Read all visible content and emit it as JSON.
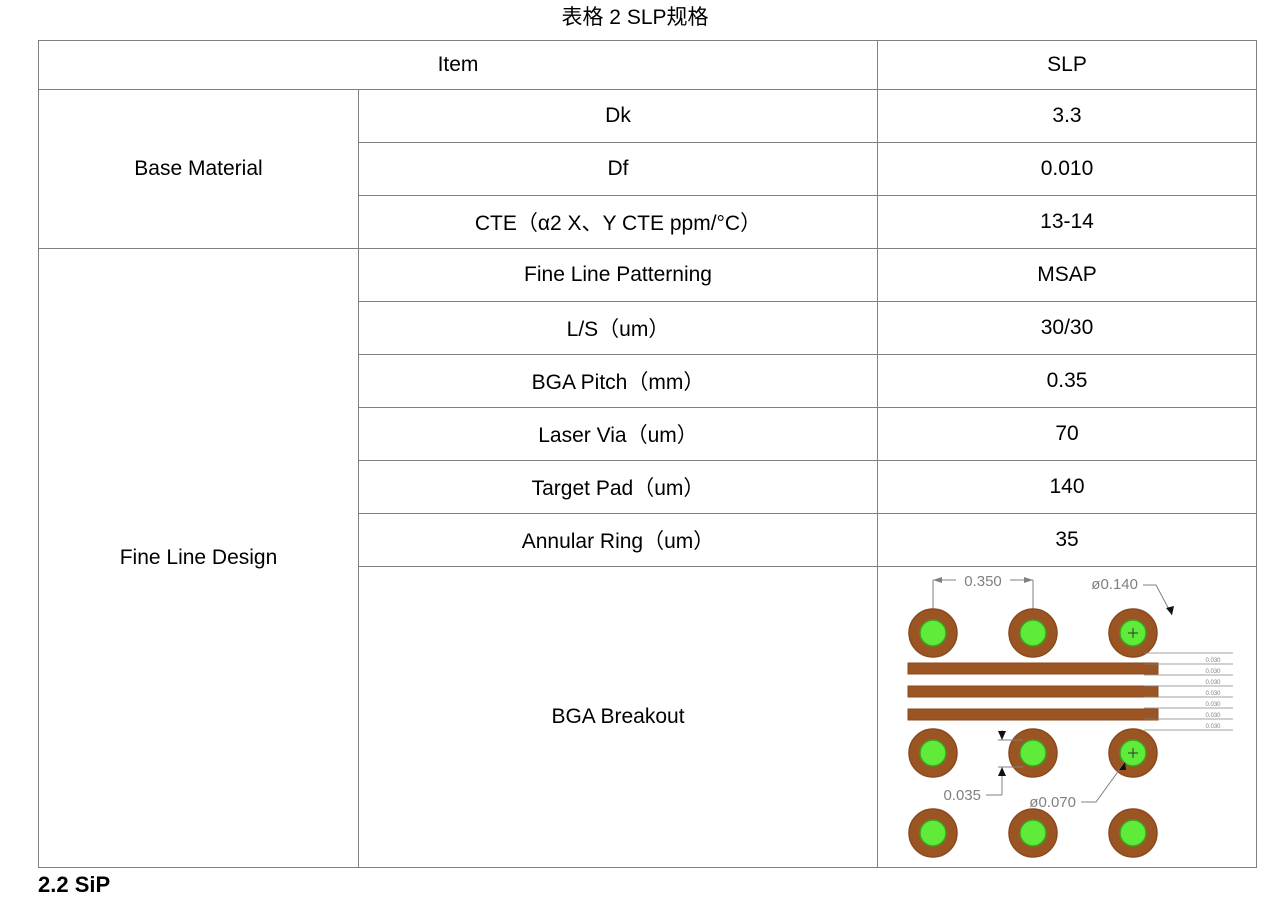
{
  "title": "表格 2 SLP规格",
  "table": {
    "header": {
      "item_label": "Item",
      "value_label": "SLP"
    },
    "groups": [
      {
        "name": "Base Material",
        "rows": [
          {
            "item": "Dk",
            "value": "3.3"
          },
          {
            "item": "Df",
            "value": "0.010"
          },
          {
            "item": "CTE（α2 X、Y CTE ppm/°C）",
            "value": "13-14"
          }
        ]
      },
      {
        "name": "Fine Line Design",
        "rows": [
          {
            "item": "Fine Line Patterning",
            "value": "MSAP"
          },
          {
            "item": "L/S（um）",
            "value": "30/30"
          },
          {
            "item": "BGA Pitch（mm）",
            "value": "0.35"
          },
          {
            "item": "Laser Via（um）",
            "value": "70"
          },
          {
            "item": "Target Pad（um）",
            "value": "140"
          },
          {
            "item": "Annular Ring（um）",
            "value": "35"
          },
          {
            "item": "BGA Breakout",
            "value": "diagram"
          }
        ]
      }
    ]
  },
  "diagram": {
    "name": "bga-breakout-drawing",
    "colors": {
      "pad_outer": "#9A5523",
      "pad_outer_stroke": "#8A4A1E",
      "via_inner": "#5FEB39",
      "via_inner_stroke": "#3FA020",
      "trace": "#9A5523",
      "dim_line": "#808080",
      "dim_text": "#808080"
    },
    "labels": {
      "pitch": "0.350",
      "target_pad_dia": "ø0.140",
      "annular_ring": "0.035",
      "laser_via_dia": "ø0.070",
      "trace_dims": [
        "0.030",
        "0.030",
        "0.030",
        "0.030",
        "0.030",
        "0.030",
        "0.030"
      ]
    },
    "pad_rows": 3,
    "pad_cols": 3,
    "trace_count": 3
  },
  "footer": {
    "heading": "2.2 SiP"
  }
}
